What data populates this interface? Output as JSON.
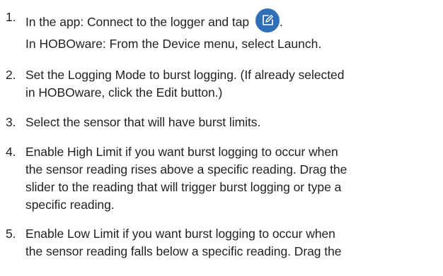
{
  "steps": [
    {
      "number": "1.",
      "line1_prefix": "In the app: Connect to the logger and tap",
      "line1_suffix": ".",
      "icon": "edit-icon",
      "line2": "In HOBOware: From the Device menu, select Launch."
    },
    {
      "number": "2.",
      "lines": [
        "Set the Logging Mode to burst logging. (If already selected",
        "in HOBOware, click the Edit button.)"
      ]
    },
    {
      "number": "3.",
      "lines": [
        "Select the sensor that will have burst limits."
      ]
    },
    {
      "number": "4.",
      "lines": [
        "Enable High Limit if you want burst logging to occur when",
        "the sensor reading rises above a specific reading. Drag the",
        "slider to the reading that will trigger burst logging or type a",
        "specific reading."
      ]
    },
    {
      "number": "5.",
      "lines": [
        "Enable Low Limit if you want burst logging to occur when",
        "the sensor reading falls below a specific reading. Drag the"
      ]
    }
  ],
  "colors": {
    "text": "#231f20",
    "icon_bg": "#2f6fb5"
  }
}
